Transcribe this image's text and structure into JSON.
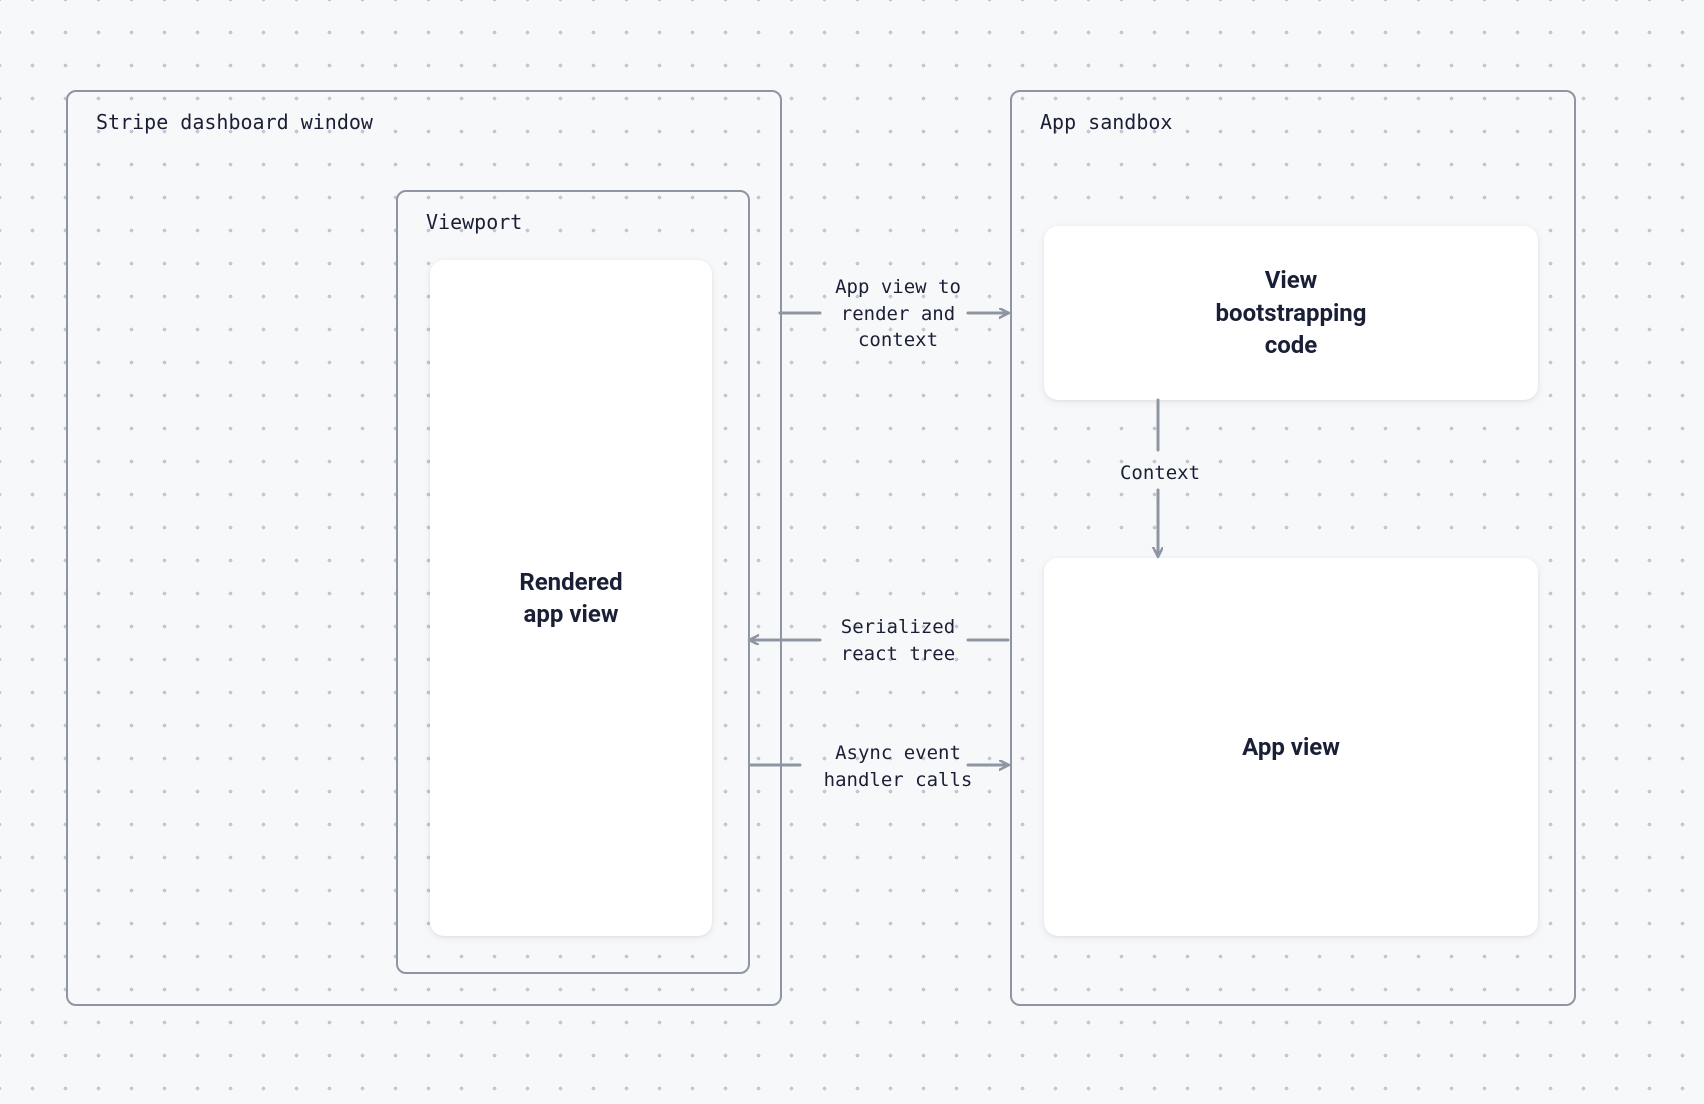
{
  "containers": {
    "stripe_dashboard": {
      "label": "Stripe dashboard window"
    },
    "app_sandbox": {
      "label": "App sandbox"
    },
    "viewport": {
      "label": "Viewport"
    }
  },
  "nodes": {
    "rendered_app_view": {
      "line1": "Rendered",
      "line2": "app view"
    },
    "view_bootstrapping": {
      "line1": "View",
      "line2": "bootstrapping",
      "line3": "code"
    },
    "app_view": {
      "line1": "App view"
    }
  },
  "edges": {
    "app_view_to_render": {
      "line1": "App view to",
      "line2": "render and",
      "line3": "context"
    },
    "context": {
      "line1": "Context"
    },
    "serialized_react": {
      "line1": "Serialized",
      "line2": "react tree"
    },
    "async_event": {
      "line1": "Async event",
      "line2": "handler calls"
    }
  },
  "style": {
    "border_color": "#8f96a3",
    "arrow_color": "#8f96a3",
    "text_color": "#1a1f36",
    "bg_color": "#f7f8fa"
  }
}
